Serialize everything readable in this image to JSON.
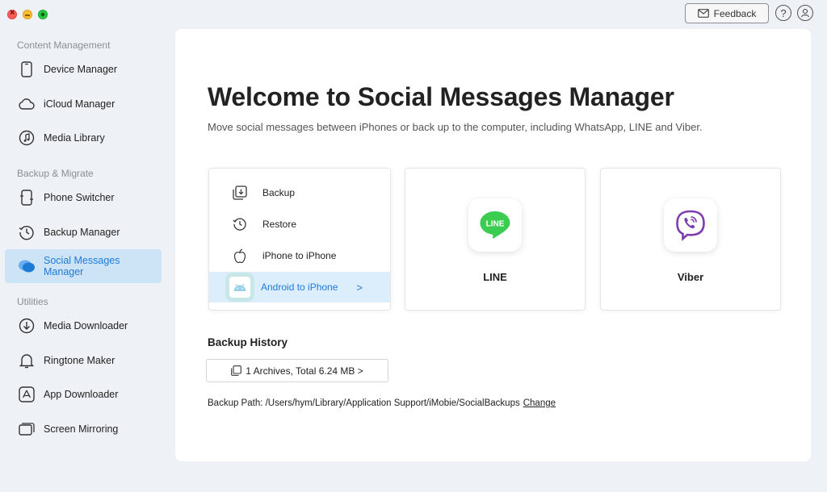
{
  "header": {
    "feedback_label": "Feedback",
    "help_symbol": "?"
  },
  "sidebar": {
    "sections": [
      {
        "label": "Content Management"
      },
      {
        "label": "Backup & Migrate"
      },
      {
        "label": "Utilities"
      }
    ],
    "items": [
      {
        "label": "Device Manager",
        "icon": "phone-icon"
      },
      {
        "label": "iCloud Manager",
        "icon": "cloud-icon"
      },
      {
        "label": "Media Library",
        "icon": "music-icon"
      },
      {
        "label": "Phone Switcher",
        "icon": "phone-switch-icon"
      },
      {
        "label": "Backup Manager",
        "icon": "history-icon"
      },
      {
        "label": "Social Messages Manager",
        "icon": "chat-bubbles-icon",
        "active": true
      },
      {
        "label": "Media Downloader",
        "icon": "download-icon"
      },
      {
        "label": "Ringtone Maker",
        "icon": "bell-icon"
      },
      {
        "label": "App Downloader",
        "icon": "app-store-icon"
      },
      {
        "label": "Screen Mirroring",
        "icon": "screen-mirror-icon"
      }
    ],
    "collapse_symbol": "‹"
  },
  "main": {
    "title": "Welcome to Social Messages Manager",
    "subtitle": "Move social messages between iPhones or back up to the computer, including WhatsApp, LINE and Viber.",
    "whatsapp_menu": [
      {
        "label": "Backup",
        "icon": "backup-icon"
      },
      {
        "label": "Restore",
        "icon": "restore-icon"
      },
      {
        "label": "iPhone to iPhone",
        "icon": "apple-icon"
      },
      {
        "label": "Android to iPhone",
        "icon": "android-icon",
        "active": true
      }
    ],
    "menu_chevron": ">",
    "apps": [
      {
        "name": "LINE",
        "icon_text": "LINE",
        "color": "#3acd51"
      },
      {
        "name": "Viber",
        "color": "#7d3daf"
      }
    ],
    "backup_history": {
      "title": "Backup History",
      "archives_label": "1 Archives, Total  6.24 MB >",
      "path_label": "Backup Path: /Users/hym/Library/Application Support/iMobie/SocialBackups",
      "change_label": "Change"
    }
  },
  "colors": {
    "accent": "#1e7ad7",
    "active_bg": "#cde4f7",
    "background": "#eef1f5"
  }
}
